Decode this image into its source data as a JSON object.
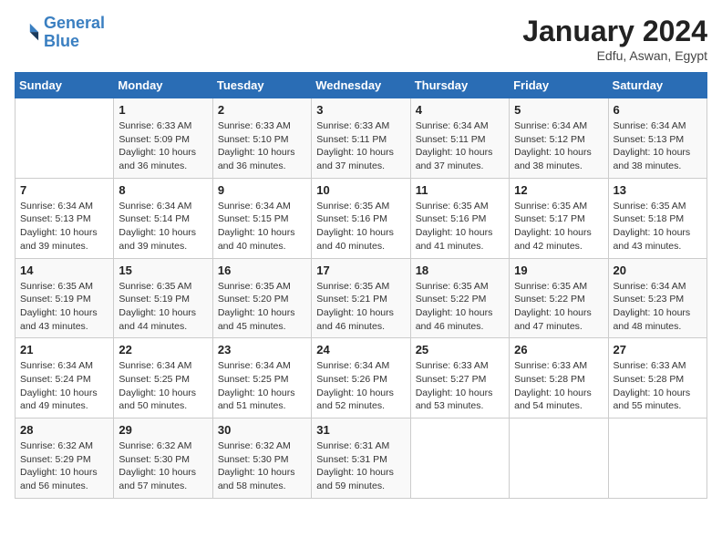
{
  "header": {
    "logo_line1": "General",
    "logo_line2": "Blue",
    "month_title": "January 2024",
    "location": "Edfu, Aswan, Egypt"
  },
  "days_of_week": [
    "Sunday",
    "Monday",
    "Tuesday",
    "Wednesday",
    "Thursday",
    "Friday",
    "Saturday"
  ],
  "weeks": [
    [
      {
        "num": "",
        "sunrise": "",
        "sunset": "",
        "daylight": ""
      },
      {
        "num": "1",
        "sunrise": "Sunrise: 6:33 AM",
        "sunset": "Sunset: 5:09 PM",
        "daylight": "Daylight: 10 hours and 36 minutes."
      },
      {
        "num": "2",
        "sunrise": "Sunrise: 6:33 AM",
        "sunset": "Sunset: 5:10 PM",
        "daylight": "Daylight: 10 hours and 36 minutes."
      },
      {
        "num": "3",
        "sunrise": "Sunrise: 6:33 AM",
        "sunset": "Sunset: 5:11 PM",
        "daylight": "Daylight: 10 hours and 37 minutes."
      },
      {
        "num": "4",
        "sunrise": "Sunrise: 6:34 AM",
        "sunset": "Sunset: 5:11 PM",
        "daylight": "Daylight: 10 hours and 37 minutes."
      },
      {
        "num": "5",
        "sunrise": "Sunrise: 6:34 AM",
        "sunset": "Sunset: 5:12 PM",
        "daylight": "Daylight: 10 hours and 38 minutes."
      },
      {
        "num": "6",
        "sunrise": "Sunrise: 6:34 AM",
        "sunset": "Sunset: 5:13 PM",
        "daylight": "Daylight: 10 hours and 38 minutes."
      }
    ],
    [
      {
        "num": "7",
        "sunrise": "Sunrise: 6:34 AM",
        "sunset": "Sunset: 5:13 PM",
        "daylight": "Daylight: 10 hours and 39 minutes."
      },
      {
        "num": "8",
        "sunrise": "Sunrise: 6:34 AM",
        "sunset": "Sunset: 5:14 PM",
        "daylight": "Daylight: 10 hours and 39 minutes."
      },
      {
        "num": "9",
        "sunrise": "Sunrise: 6:34 AM",
        "sunset": "Sunset: 5:15 PM",
        "daylight": "Daylight: 10 hours and 40 minutes."
      },
      {
        "num": "10",
        "sunrise": "Sunrise: 6:35 AM",
        "sunset": "Sunset: 5:16 PM",
        "daylight": "Daylight: 10 hours and 40 minutes."
      },
      {
        "num": "11",
        "sunrise": "Sunrise: 6:35 AM",
        "sunset": "Sunset: 5:16 PM",
        "daylight": "Daylight: 10 hours and 41 minutes."
      },
      {
        "num": "12",
        "sunrise": "Sunrise: 6:35 AM",
        "sunset": "Sunset: 5:17 PM",
        "daylight": "Daylight: 10 hours and 42 minutes."
      },
      {
        "num": "13",
        "sunrise": "Sunrise: 6:35 AM",
        "sunset": "Sunset: 5:18 PM",
        "daylight": "Daylight: 10 hours and 43 minutes."
      }
    ],
    [
      {
        "num": "14",
        "sunrise": "Sunrise: 6:35 AM",
        "sunset": "Sunset: 5:19 PM",
        "daylight": "Daylight: 10 hours and 43 minutes."
      },
      {
        "num": "15",
        "sunrise": "Sunrise: 6:35 AM",
        "sunset": "Sunset: 5:19 PM",
        "daylight": "Daylight: 10 hours and 44 minutes."
      },
      {
        "num": "16",
        "sunrise": "Sunrise: 6:35 AM",
        "sunset": "Sunset: 5:20 PM",
        "daylight": "Daylight: 10 hours and 45 minutes."
      },
      {
        "num": "17",
        "sunrise": "Sunrise: 6:35 AM",
        "sunset": "Sunset: 5:21 PM",
        "daylight": "Daylight: 10 hours and 46 minutes."
      },
      {
        "num": "18",
        "sunrise": "Sunrise: 6:35 AM",
        "sunset": "Sunset: 5:22 PM",
        "daylight": "Daylight: 10 hours and 46 minutes."
      },
      {
        "num": "19",
        "sunrise": "Sunrise: 6:35 AM",
        "sunset": "Sunset: 5:22 PM",
        "daylight": "Daylight: 10 hours and 47 minutes."
      },
      {
        "num": "20",
        "sunrise": "Sunrise: 6:34 AM",
        "sunset": "Sunset: 5:23 PM",
        "daylight": "Daylight: 10 hours and 48 minutes."
      }
    ],
    [
      {
        "num": "21",
        "sunrise": "Sunrise: 6:34 AM",
        "sunset": "Sunset: 5:24 PM",
        "daylight": "Daylight: 10 hours and 49 minutes."
      },
      {
        "num": "22",
        "sunrise": "Sunrise: 6:34 AM",
        "sunset": "Sunset: 5:25 PM",
        "daylight": "Daylight: 10 hours and 50 minutes."
      },
      {
        "num": "23",
        "sunrise": "Sunrise: 6:34 AM",
        "sunset": "Sunset: 5:25 PM",
        "daylight": "Daylight: 10 hours and 51 minutes."
      },
      {
        "num": "24",
        "sunrise": "Sunrise: 6:34 AM",
        "sunset": "Sunset: 5:26 PM",
        "daylight": "Daylight: 10 hours and 52 minutes."
      },
      {
        "num": "25",
        "sunrise": "Sunrise: 6:33 AM",
        "sunset": "Sunset: 5:27 PM",
        "daylight": "Daylight: 10 hours and 53 minutes."
      },
      {
        "num": "26",
        "sunrise": "Sunrise: 6:33 AM",
        "sunset": "Sunset: 5:28 PM",
        "daylight": "Daylight: 10 hours and 54 minutes."
      },
      {
        "num": "27",
        "sunrise": "Sunrise: 6:33 AM",
        "sunset": "Sunset: 5:28 PM",
        "daylight": "Daylight: 10 hours and 55 minutes."
      }
    ],
    [
      {
        "num": "28",
        "sunrise": "Sunrise: 6:32 AM",
        "sunset": "Sunset: 5:29 PM",
        "daylight": "Daylight: 10 hours and 56 minutes."
      },
      {
        "num": "29",
        "sunrise": "Sunrise: 6:32 AM",
        "sunset": "Sunset: 5:30 PM",
        "daylight": "Daylight: 10 hours and 57 minutes."
      },
      {
        "num": "30",
        "sunrise": "Sunrise: 6:32 AM",
        "sunset": "Sunset: 5:30 PM",
        "daylight": "Daylight: 10 hours and 58 minutes."
      },
      {
        "num": "31",
        "sunrise": "Sunrise: 6:31 AM",
        "sunset": "Sunset: 5:31 PM",
        "daylight": "Daylight: 10 hours and 59 minutes."
      },
      {
        "num": "",
        "sunrise": "",
        "sunset": "",
        "daylight": ""
      },
      {
        "num": "",
        "sunrise": "",
        "sunset": "",
        "daylight": ""
      },
      {
        "num": "",
        "sunrise": "",
        "sunset": "",
        "daylight": ""
      }
    ]
  ]
}
